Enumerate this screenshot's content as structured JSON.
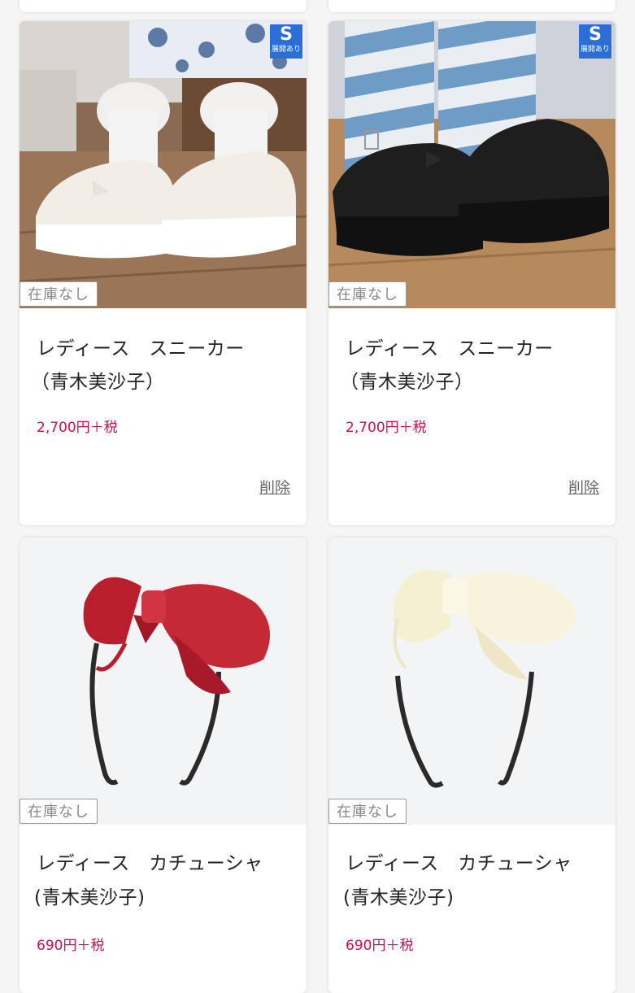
{
  "products": [
    {
      "badge_size": "S",
      "badge_text": "展開あり",
      "stock_label": "在庫なし",
      "title_line1": "レディース　スニーカー",
      "title_line2": "（青木美沙子）",
      "price": "2,700円＋税",
      "delete_label": "削除",
      "image": "white-platform-shoes"
    },
    {
      "badge_size": "S",
      "badge_text": "展開あり",
      "stock_label": "在庫なし",
      "title_line1": "レディース　スニーカー",
      "title_line2": "（青木美沙子）",
      "price": "2,700円＋税",
      "delete_label": "削除",
      "image": "black-platform-shoes"
    },
    {
      "stock_label": "在庫なし",
      "title_line1": "レディース　カチューシャ",
      "title_line2": "(青木美沙子)",
      "price": "690円＋税",
      "image": "red-bow-headband"
    },
    {
      "stock_label": "在庫なし",
      "title_line1": "レディース　カチューシャ",
      "title_line2": "(青木美沙子)",
      "price": "690円＋税",
      "image": "cream-bow-headband"
    }
  ],
  "colors": {
    "price": "#c8104f",
    "badge": "#2b6fd6",
    "background": "#f5f5f5"
  }
}
